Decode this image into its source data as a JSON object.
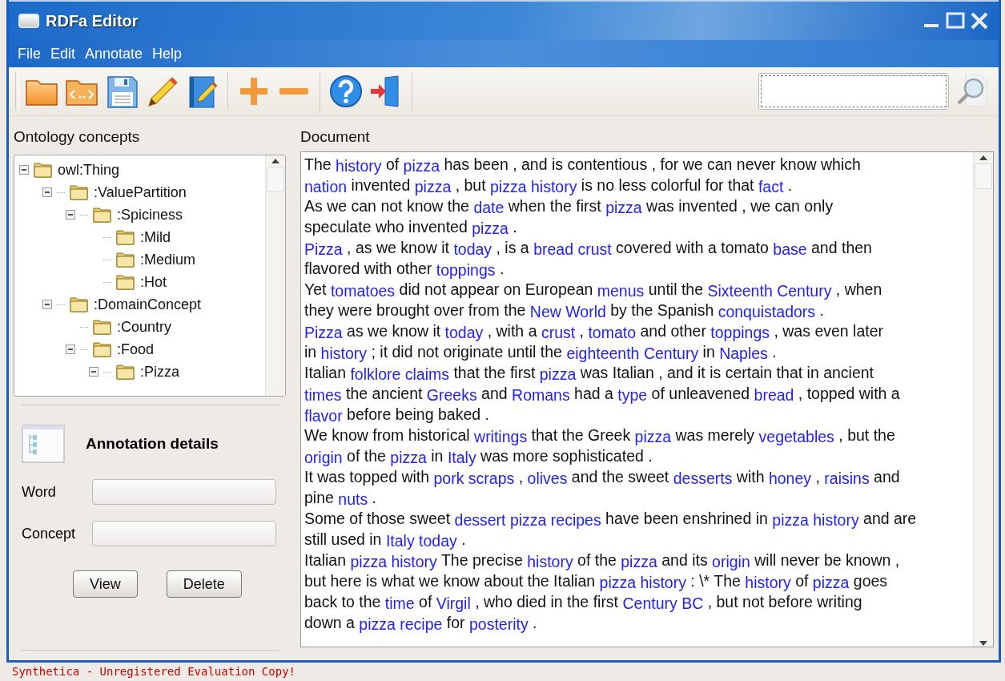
{
  "window": {
    "title": "RDFa Editor"
  },
  "menu": [
    "File",
    "Edit",
    "Annotate",
    "Help"
  ],
  "search": {
    "focused": true
  },
  "ontology_panel": {
    "title": "Ontology concepts",
    "tree": [
      {
        "label": "owl:Thing",
        "expanded": true,
        "children": [
          {
            "label": ":ValuePartition",
            "expanded": true,
            "children": [
              {
                "label": ":Spiciness",
                "expanded": true,
                "children": [
                  {
                    "label": ":Mild"
                  },
                  {
                    "label": ":Medium"
                  },
                  {
                    "label": ":Hot"
                  }
                ]
              }
            ]
          },
          {
            "label": ":DomainConcept",
            "expanded": true,
            "children": [
              {
                "label": ":Country"
              },
              {
                "label": ":Food",
                "expanded": true,
                "children": [
                  {
                    "label": ":Pizza",
                    "expanded": true
                  }
                ]
              }
            ]
          }
        ]
      }
    ]
  },
  "annotation_details": {
    "title": "Annotation details",
    "fields": [
      {
        "label": "Word"
      },
      {
        "label": "Concept"
      }
    ],
    "buttons": [
      "View",
      "Delete"
    ]
  },
  "document": {
    "title": "Document",
    "lines": [
      [
        {
          "text": "The ",
          "annotated": false
        },
        {
          "text": "history",
          "annotated": true
        },
        {
          "text": " of ",
          "annotated": false
        },
        {
          "text": "pizza",
          "annotated": true
        },
        {
          "text": " has been , and is contentious , for we can never know which",
          "annotated": false
        }
      ],
      [
        {
          "text": "nation",
          "annotated": true
        },
        {
          "text": " invented ",
          "annotated": false
        },
        {
          "text": "pizza",
          "annotated": true
        },
        {
          "text": " , but ",
          "annotated": false
        },
        {
          "text": "pizza history",
          "annotated": true
        },
        {
          "text": " is no less colorful for that ",
          "annotated": false
        },
        {
          "text": "fact",
          "annotated": true
        },
        {
          "text": " .",
          "annotated": false
        }
      ],
      [
        {
          "text": "As we can not know the ",
          "annotated": false
        },
        {
          "text": "date",
          "annotated": true
        },
        {
          "text": " when the first ",
          "annotated": false
        },
        {
          "text": "pizza",
          "annotated": true
        },
        {
          "text": " was invented , we can only",
          "annotated": false
        }
      ],
      [
        {
          "text": "speculate who invented ",
          "annotated": false
        },
        {
          "text": "pizza",
          "annotated": true
        },
        {
          "text": " .",
          "annotated": false
        }
      ],
      [
        {
          "text": "Pizza",
          "annotated": true
        },
        {
          "text": " , as we know it ",
          "annotated": false
        },
        {
          "text": "today",
          "annotated": true
        },
        {
          "text": " , is a ",
          "annotated": false
        },
        {
          "text": "bread crust",
          "annotated": true
        },
        {
          "text": " covered with a tomato ",
          "annotated": false
        },
        {
          "text": "base",
          "annotated": true
        },
        {
          "text": " and then",
          "annotated": false
        }
      ],
      [
        {
          "text": "flavored with other ",
          "annotated": false
        },
        {
          "text": "toppings",
          "annotated": true
        },
        {
          "text": " .",
          "annotated": false
        }
      ],
      [
        {
          "text": "Yet ",
          "annotated": false
        },
        {
          "text": "tomatoes",
          "annotated": true
        },
        {
          "text": " did not appear on European ",
          "annotated": false
        },
        {
          "text": "menus",
          "annotated": true
        },
        {
          "text": " until the ",
          "annotated": false
        },
        {
          "text": "Sixteenth Century",
          "annotated": true
        },
        {
          "text": " , when",
          "annotated": false
        }
      ],
      [
        {
          "text": "they were brought over from the ",
          "annotated": false
        },
        {
          "text": "New World",
          "annotated": true
        },
        {
          "text": " by the Spanish ",
          "annotated": false
        },
        {
          "text": "conquistadors",
          "annotated": true
        },
        {
          "text": " .",
          "annotated": false
        }
      ],
      [
        {
          "text": "Pizza",
          "annotated": true
        },
        {
          "text": " as we know it ",
          "annotated": false
        },
        {
          "text": "today",
          "annotated": true
        },
        {
          "text": " , with a ",
          "annotated": false
        },
        {
          "text": "crust",
          "annotated": true
        },
        {
          "text": " , ",
          "annotated": false
        },
        {
          "text": "tomato",
          "annotated": true
        },
        {
          "text": " and other ",
          "annotated": false
        },
        {
          "text": "toppings",
          "annotated": true
        },
        {
          "text": " , was even later",
          "annotated": false
        }
      ],
      [
        {
          "text": "in ",
          "annotated": false
        },
        {
          "text": "history",
          "annotated": true
        },
        {
          "text": " ; it did not originate until the ",
          "annotated": false
        },
        {
          "text": "eighteenth Century",
          "annotated": true
        },
        {
          "text": " in ",
          "annotated": false
        },
        {
          "text": "Naples",
          "annotated": true
        },
        {
          "text": " .",
          "annotated": false
        }
      ],
      [
        {
          "text": "Italian ",
          "annotated": false
        },
        {
          "text": "folklore claims",
          "annotated": true
        },
        {
          "text": " that the first ",
          "annotated": false
        },
        {
          "text": "pizza",
          "annotated": true
        },
        {
          "text": " was Italian , and it is certain that in ancient",
          "annotated": false
        }
      ],
      [
        {
          "text": "times",
          "annotated": true
        },
        {
          "text": " the ancient ",
          "annotated": false
        },
        {
          "text": "Greeks",
          "annotated": true
        },
        {
          "text": " and ",
          "annotated": false
        },
        {
          "text": "Romans",
          "annotated": true
        },
        {
          "text": " had a ",
          "annotated": false
        },
        {
          "text": "type",
          "annotated": true
        },
        {
          "text": " of unleavened ",
          "annotated": false
        },
        {
          "text": "bread",
          "annotated": true
        },
        {
          "text": " , topped with a",
          "annotated": false
        }
      ],
      [
        {
          "text": "flavor",
          "annotated": true
        },
        {
          "text": " before being baked .",
          "annotated": false
        }
      ],
      [
        {
          "text": "We know from historical ",
          "annotated": false
        },
        {
          "text": "writings",
          "annotated": true
        },
        {
          "text": " that the Greek ",
          "annotated": false
        },
        {
          "text": "pizza",
          "annotated": true
        },
        {
          "text": " was merely ",
          "annotated": false
        },
        {
          "text": "vegetables",
          "annotated": true
        },
        {
          "text": " , but the",
          "annotated": false
        }
      ],
      [
        {
          "text": "origin",
          "annotated": true
        },
        {
          "text": " of the ",
          "annotated": false
        },
        {
          "text": "pizza",
          "annotated": true
        },
        {
          "text": " in ",
          "annotated": false
        },
        {
          "text": "Italy",
          "annotated": true
        },
        {
          "text": " was more sophisticated .",
          "annotated": false
        }
      ],
      [
        {
          "text": "It was topped with ",
          "annotated": false
        },
        {
          "text": "pork scraps",
          "annotated": true
        },
        {
          "text": " , ",
          "annotated": false
        },
        {
          "text": "olives",
          "annotated": true
        },
        {
          "text": " and the sweet ",
          "annotated": false
        },
        {
          "text": "desserts",
          "annotated": true
        },
        {
          "text": " with ",
          "annotated": false
        },
        {
          "text": "honey",
          "annotated": true
        },
        {
          "text": " , ",
          "annotated": false
        },
        {
          "text": "raisins",
          "annotated": true
        },
        {
          "text": " and",
          "annotated": false
        }
      ],
      [
        {
          "text": "pine ",
          "annotated": false
        },
        {
          "text": "nuts",
          "annotated": true
        },
        {
          "text": " .",
          "annotated": false
        }
      ],
      [
        {
          "text": "Some of those sweet ",
          "annotated": false
        },
        {
          "text": "dessert pizza recipes",
          "annotated": true
        },
        {
          "text": " have been enshrined in ",
          "annotated": false
        },
        {
          "text": "pizza history",
          "annotated": true
        },
        {
          "text": " and are",
          "annotated": false
        }
      ],
      [
        {
          "text": "still used in ",
          "annotated": false
        },
        {
          "text": "Italy today",
          "annotated": true
        },
        {
          "text": " .",
          "annotated": false
        }
      ],
      [
        {
          "text": "Italian ",
          "annotated": false
        },
        {
          "text": "pizza history",
          "annotated": true
        },
        {
          "text": " The precise ",
          "annotated": false
        },
        {
          "text": "history",
          "annotated": true
        },
        {
          "text": " of the ",
          "annotated": false
        },
        {
          "text": "pizza",
          "annotated": true
        },
        {
          "text": " and its ",
          "annotated": false
        },
        {
          "text": "origin",
          "annotated": true
        },
        {
          "text": " will never be known ,",
          "annotated": false
        }
      ],
      [
        {
          "text": "but here is what we know about the Italian ",
          "annotated": false
        },
        {
          "text": "pizza history",
          "annotated": true
        },
        {
          "text": " : \\* The ",
          "annotated": false
        },
        {
          "text": "history",
          "annotated": true
        },
        {
          "text": " of ",
          "annotated": false
        },
        {
          "text": "pizza",
          "annotated": true
        },
        {
          "text": " goes",
          "annotated": false
        }
      ],
      [
        {
          "text": "back to the ",
          "annotated": false
        },
        {
          "text": "time",
          "annotated": true
        },
        {
          "text": " of ",
          "annotated": false
        },
        {
          "text": "Virgil",
          "annotated": true
        },
        {
          "text": " , who died in the first ",
          "annotated": false
        },
        {
          "text": "Century BC",
          "annotated": true
        },
        {
          "text": " , but not before writing",
          "annotated": false
        }
      ],
      [
        {
          "text": "down a ",
          "annotated": false
        },
        {
          "text": "pizza recipe",
          "annotated": true
        },
        {
          "text": " for ",
          "annotated": false
        },
        {
          "text": "posterity",
          "annotated": true
        },
        {
          "text": " .",
          "annotated": false
        }
      ]
    ]
  },
  "status_text": "Synthetica - Unregistered Evaluation Copy!"
}
